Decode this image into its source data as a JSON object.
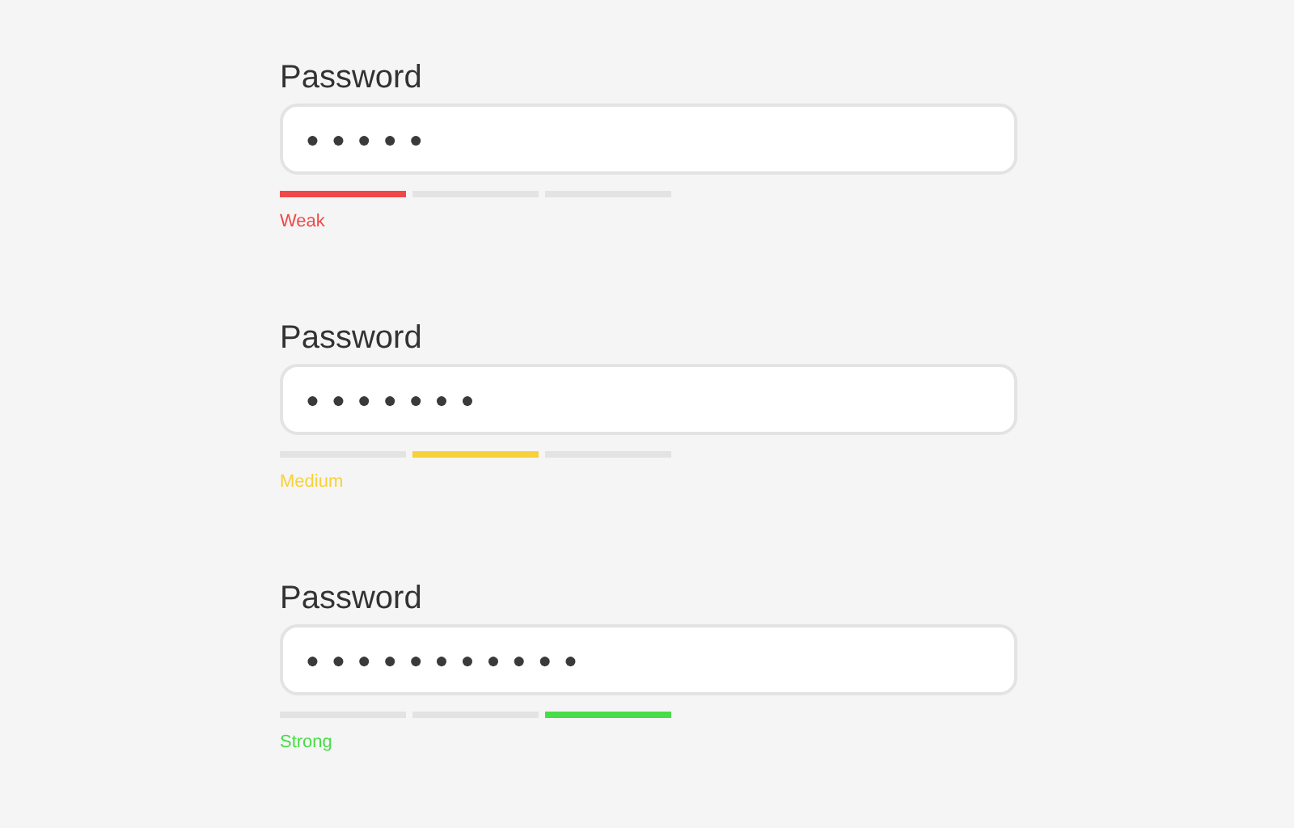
{
  "fields": [
    {
      "label": "Password",
      "value": "●●●●●",
      "strength": "Weak",
      "color": "#f04848",
      "segments": [
        {
          "on": true
        },
        {
          "on": false
        },
        {
          "on": false
        }
      ]
    },
    {
      "label": "Password",
      "value": "●●●●●●●",
      "strength": "Medium",
      "color": "#f7d13a",
      "segments": [
        {
          "on": false
        },
        {
          "on": true
        },
        {
          "on": false
        }
      ]
    },
    {
      "label": "Password",
      "value": "●●●●●●●●●●●",
      "strength": "Strong",
      "color": "#48dc48",
      "segments": [
        {
          "on": false
        },
        {
          "on": false
        },
        {
          "on": true
        }
      ]
    }
  ]
}
